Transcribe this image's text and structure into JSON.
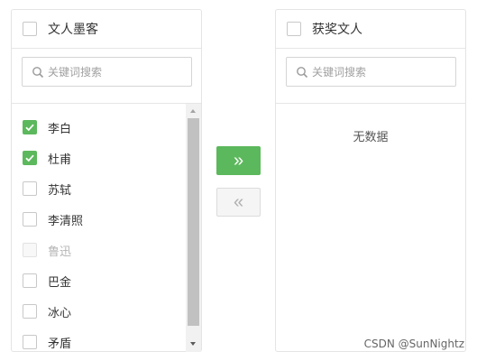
{
  "source_panel": {
    "title": "文人墨客",
    "search_placeholder": "关键词搜索",
    "items": [
      {
        "label": "李白",
        "checked": true,
        "disabled": false
      },
      {
        "label": "杜甫",
        "checked": true,
        "disabled": false
      },
      {
        "label": "苏轼",
        "checked": false,
        "disabled": false
      },
      {
        "label": "李清照",
        "checked": false,
        "disabled": false
      },
      {
        "label": "鲁迅",
        "checked": false,
        "disabled": true
      },
      {
        "label": "巴金",
        "checked": false,
        "disabled": false
      },
      {
        "label": "冰心",
        "checked": false,
        "disabled": false
      },
      {
        "label": "矛盾",
        "checked": false,
        "disabled": false
      }
    ]
  },
  "target_panel": {
    "title": "获奖文人",
    "search_placeholder": "关键词搜索",
    "empty_text": "无数据"
  },
  "transfer_buttons": {
    "to_right_icon": "double-chevron-right-icon",
    "to_left_icon": "double-chevron-left-icon",
    "to_right_symbol": "»",
    "to_left_symbol": "«"
  },
  "watermark": "CSDN @SunNightz",
  "colors": {
    "accent": "#5cb85c",
    "border": "#e4e4e4",
    "disabled_text": "#b4b4b4"
  }
}
